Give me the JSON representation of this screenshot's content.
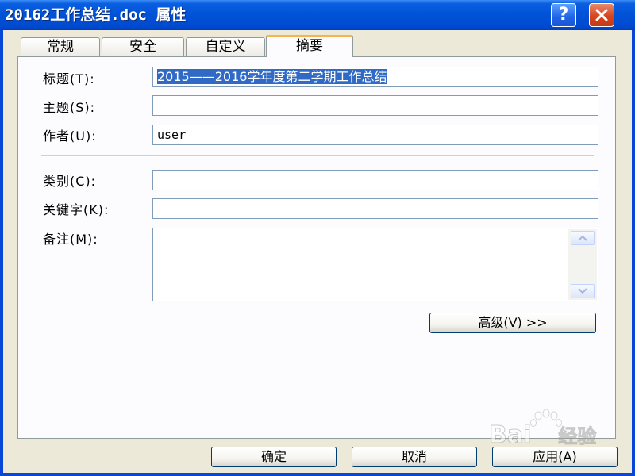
{
  "window": {
    "title": "20162工作总结.doc 属性",
    "help_glyph": "?",
    "close_glyph": "✕"
  },
  "tabs": [
    {
      "label": "常规",
      "active": false
    },
    {
      "label": "安全",
      "active": false
    },
    {
      "label": "自定义",
      "active": false
    },
    {
      "label": "摘要",
      "active": true
    }
  ],
  "fields": {
    "title": {
      "label": "标题(T):",
      "value": "2015——2016学年度第二学期工作总结"
    },
    "subject": {
      "label": "主题(S):",
      "value": ""
    },
    "author": {
      "label": "作者(U):",
      "value": "user"
    },
    "category": {
      "label": "类别(C):",
      "value": ""
    },
    "keywords": {
      "label": "关键字(K):",
      "value": ""
    },
    "comments": {
      "label": "备注(M):",
      "value": ""
    }
  },
  "buttons": {
    "advanced": "高级(V) >>",
    "ok": "确定",
    "cancel": "取消",
    "apply": "应用(A)"
  },
  "watermark": {
    "brand": "Bai",
    "suffix": "经验"
  },
  "colors": {
    "titlebar": "#0052d6",
    "selection": "#316ac5",
    "dialog_bg": "#ece9d8",
    "tab_highlight": "#f6b44a",
    "close_button": "#d6451f"
  }
}
